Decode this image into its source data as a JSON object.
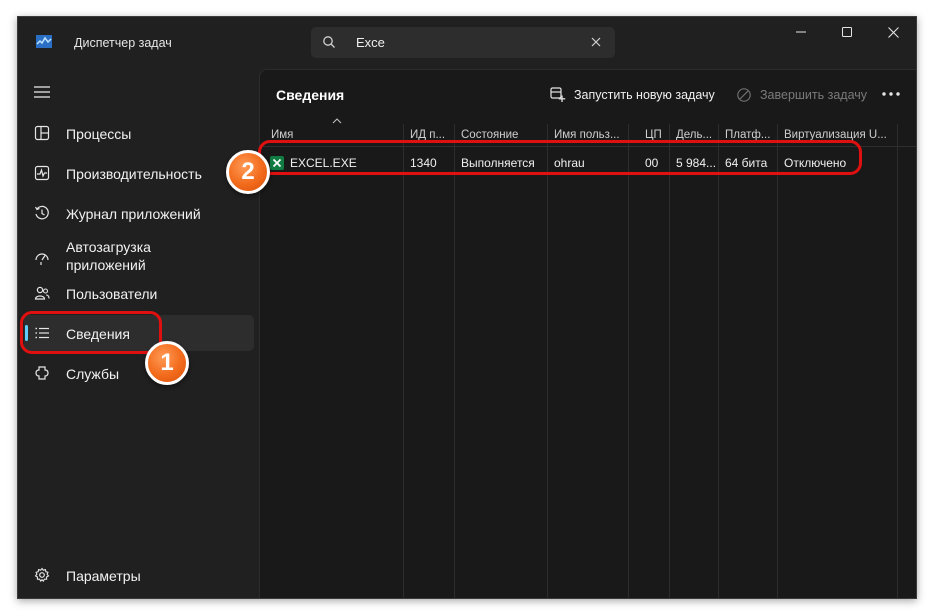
{
  "window": {
    "title": "Диспетчер задач"
  },
  "search": {
    "value": "Exce"
  },
  "window_controls": [
    "minimize-icon",
    "maximize-icon",
    "close-icon"
  ],
  "sidebar": {
    "items": [
      {
        "label": "Процессы",
        "icon": "processes-icon"
      },
      {
        "label": "Производительность",
        "icon": "performance-icon"
      },
      {
        "label": "Журнал приложений",
        "icon": "app-history-icon"
      },
      {
        "label": "Автозагрузка приложений",
        "icon": "startup-apps-icon"
      },
      {
        "label": "Пользователи",
        "icon": "users-icon"
      },
      {
        "label": "Сведения",
        "icon": "details-icon",
        "active": true
      },
      {
        "label": "Службы",
        "icon": "services-icon"
      }
    ],
    "footer": {
      "label": "Параметры",
      "icon": "settings-icon"
    }
  },
  "main": {
    "title": "Сведения",
    "commands": {
      "run_new_task": "Запустить новую задачу",
      "end_task": "Завершить задачу"
    }
  },
  "table": {
    "columns": [
      "Имя",
      "ИД п...",
      "Состояние",
      "Имя польз...",
      "ЦП",
      "Дель...",
      "Платф...",
      "Виртуализация U..."
    ],
    "rows": [
      {
        "name": "EXCEL.EXE",
        "pid": "1340",
        "status": "Выполняется",
        "user": "ohrau",
        "cpu": "00",
        "memory": "5 984...",
        "platform": "64 бита",
        "virtualization": "Отключено"
      }
    ]
  },
  "annotations": {
    "badge1": "1",
    "badge2": "2"
  },
  "colors": {
    "accent": "#60cdff",
    "highlight": "#e01010",
    "badge": "#f26a1b",
    "excel": "#107c41"
  }
}
